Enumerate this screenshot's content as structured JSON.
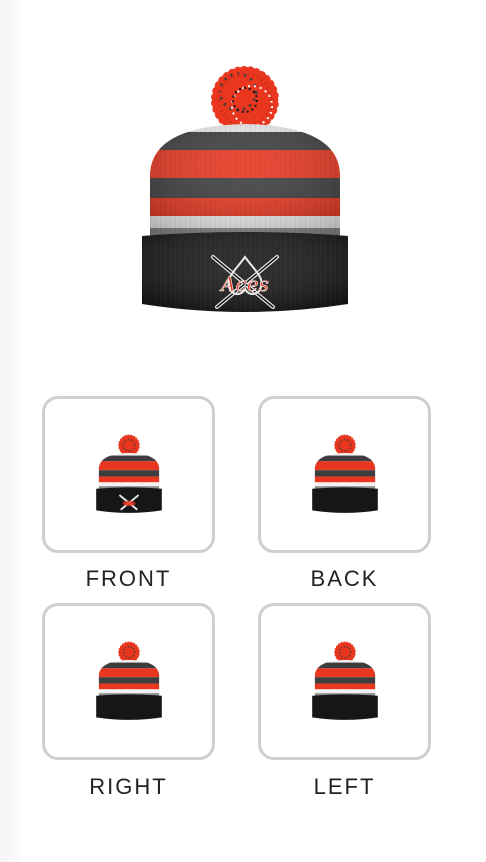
{
  "product": {
    "logo_text": "Aces",
    "colors": {
      "red": "#e8361f",
      "charcoal": "#3d3d3d",
      "white": "#f2f2f2",
      "black": "#161616"
    }
  },
  "views": [
    {
      "id": "front",
      "label": "FRONT",
      "selected": true,
      "shows_logo": true
    },
    {
      "id": "back",
      "label": "BACK",
      "selected": false,
      "shows_logo": false
    },
    {
      "id": "right",
      "label": "RIGHT",
      "selected": false,
      "shows_logo": false
    },
    {
      "id": "left",
      "label": "LEFT",
      "selected": false,
      "shows_logo": false
    }
  ]
}
